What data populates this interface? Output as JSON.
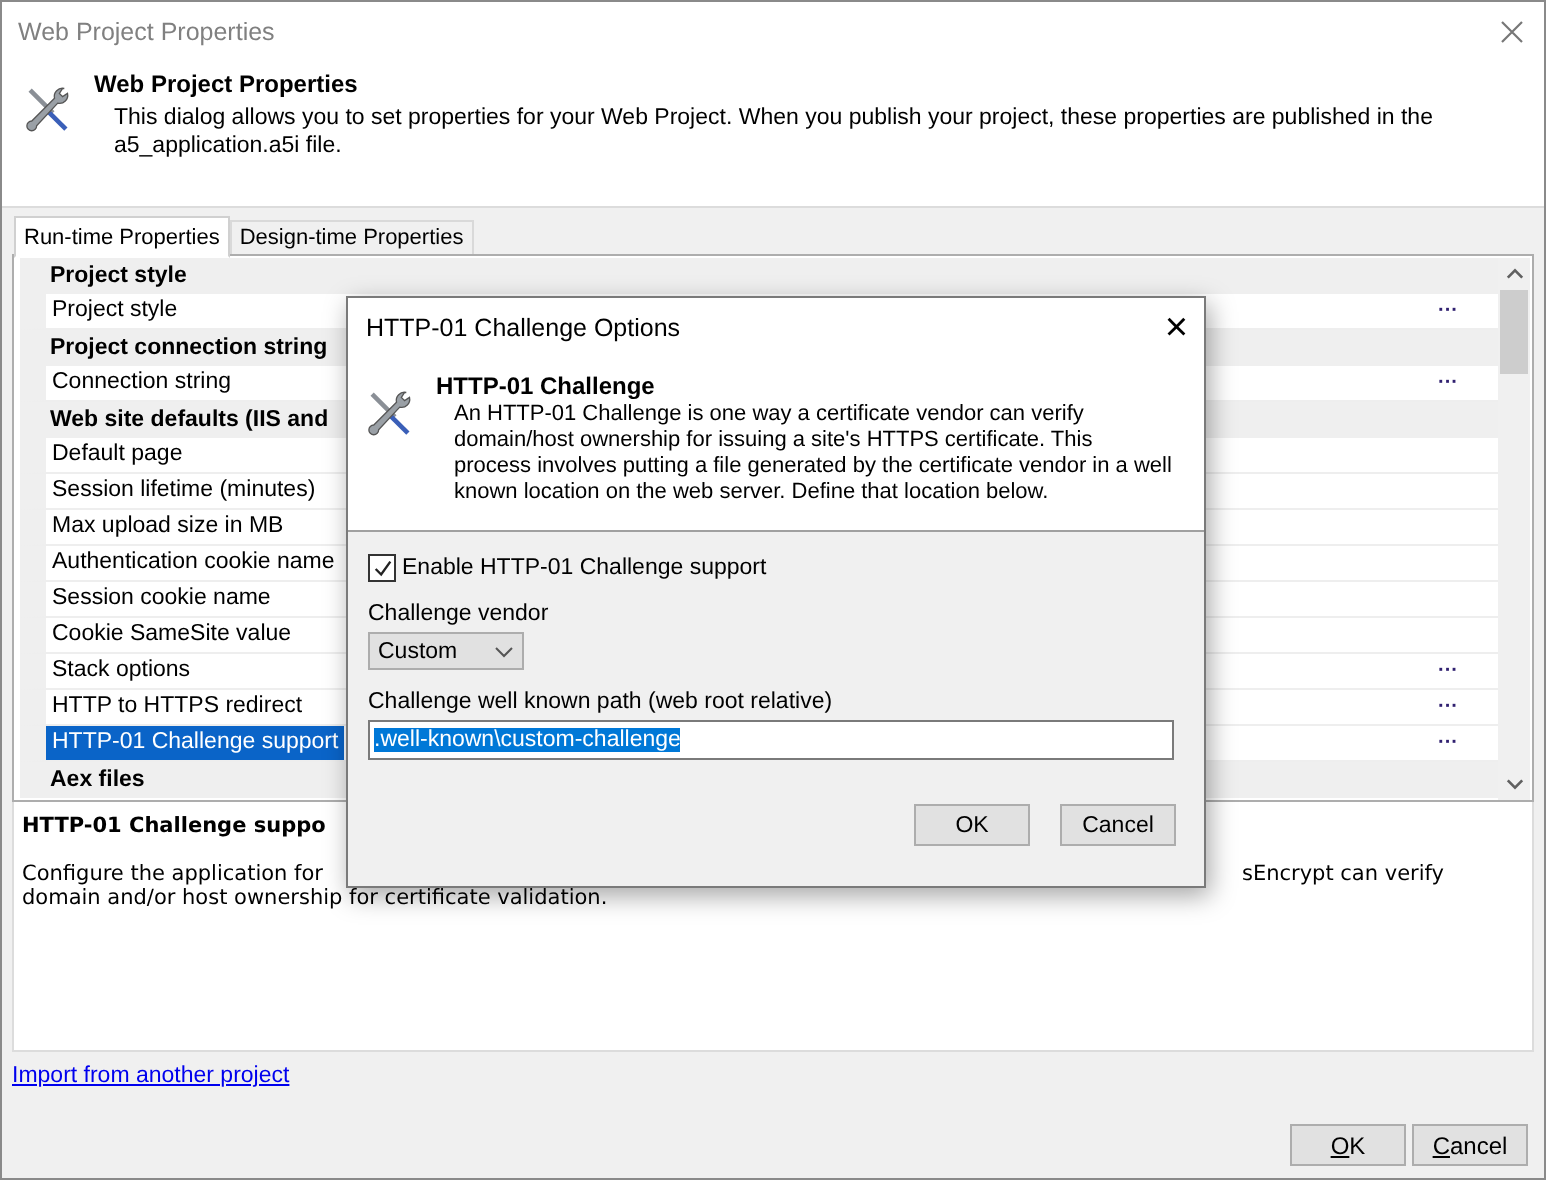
{
  "window": {
    "title": "Web Project Properties"
  },
  "header": {
    "title": "Web Project Properties",
    "text": "This dialog allows you to set properties for your Web Project. When you publish your project, these properties are published in the a5_application.a5i file."
  },
  "tabs": [
    {
      "label": "Run-time Properties",
      "selected": true
    },
    {
      "label": "Design-time Properties",
      "selected": false
    }
  ],
  "grid": {
    "rows": [
      {
        "kind": "category",
        "label": "Project style"
      },
      {
        "kind": "property",
        "label": "Project style",
        "selected": false,
        "has_button": true
      },
      {
        "kind": "category",
        "label": "Project connection string"
      },
      {
        "kind": "property",
        "label": "Connection string",
        "selected": false,
        "has_button": true
      },
      {
        "kind": "category",
        "label": "Web site defaults (IIS and"
      },
      {
        "kind": "property",
        "label": "Default page",
        "selected": false,
        "has_button": false
      },
      {
        "kind": "property",
        "label": "Session lifetime (minutes)",
        "selected": false,
        "has_button": false
      },
      {
        "kind": "property",
        "label": "Max upload size in MB",
        "selected": false,
        "has_button": false
      },
      {
        "kind": "property",
        "label": "Authentication cookie name",
        "selected": false,
        "has_button": false
      },
      {
        "kind": "property",
        "label": "Session cookie name",
        "selected": false,
        "has_button": false
      },
      {
        "kind": "property",
        "label": "Cookie SameSite value",
        "selected": false,
        "has_button": false
      },
      {
        "kind": "property",
        "label": "Stack options",
        "selected": false,
        "has_button": true
      },
      {
        "kind": "property",
        "label": "HTTP to HTTPS redirect",
        "selected": false,
        "has_button": true
      },
      {
        "kind": "property",
        "label": "HTTP-01 Challenge support",
        "selected": true,
        "has_button": true
      },
      {
        "kind": "category",
        "label": "Aex files"
      }
    ],
    "button_label": "···"
  },
  "description": {
    "title": "HTTP-01 Challenge suppo",
    "line_1_left": "Configure the application for",
    "line_1_right": "sEncrypt can verify",
    "line_2": "domain and/or host ownership for certificate validation."
  },
  "link": "Import from another project",
  "buttons": [
    {
      "label": "OK"
    },
    {
      "label": "Cancel"
    }
  ],
  "dialog": {
    "title": "HTTP-01 Challenge Options",
    "close": "×",
    "header_title": "HTTP-01 Challenge",
    "header_text": "An HTTP-01 Challenge is one way a certificate vendor can verify domain/host ownership for issuing a site's HTTPS certificate. This process involves putting a file generated by the certificate vendor in a well known location on the web server. Define that location below.",
    "checkbox": {
      "label": "Enable HTTP-01 Challenge support",
      "checked": true
    },
    "vendor": {
      "label": "Challenge vendor",
      "value": "Custom"
    },
    "path": {
      "label": "Challenge well known path (web root relative)",
      "value": ".well-known\\custom-challenge"
    },
    "buttons": [
      "OK",
      "Cancel"
    ]
  }
}
